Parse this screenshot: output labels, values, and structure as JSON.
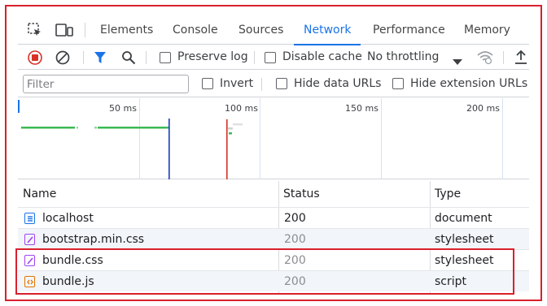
{
  "tabs": [
    {
      "label": "Elements"
    },
    {
      "label": "Console"
    },
    {
      "label": "Sources"
    },
    {
      "label": "Network",
      "active": true
    },
    {
      "label": "Performance"
    },
    {
      "label": "Memory"
    }
  ],
  "toolbar": {
    "preserve_log": "Preserve log",
    "disable_cache": "Disable cache",
    "throttling": "No throttling"
  },
  "filter": {
    "placeholder": "Filter",
    "invert": "Invert",
    "hide_data_urls": "Hide data URLs",
    "hide_extension_urls": "Hide extension URLs"
  },
  "overview": {
    "ticks": [
      "50 ms",
      "100 ms",
      "150 ms",
      "200 ms"
    ]
  },
  "table": {
    "headers": {
      "name": "Name",
      "status": "Status",
      "type": "Type"
    },
    "rows": [
      {
        "name": "localhost",
        "status": "200",
        "type": "document",
        "icon": "document-icon"
      },
      {
        "name": "bootstrap.min.css",
        "status": "200",
        "type": "stylesheet",
        "icon": "stylesheet-icon"
      },
      {
        "name": "bundle.css",
        "status": "200",
        "type": "stylesheet",
        "icon": "stylesheet-icon"
      },
      {
        "name": "bundle.js",
        "status": "200",
        "type": "script",
        "icon": "script-icon"
      }
    ]
  },
  "colors": {
    "accent": "#1a73e8",
    "highlight_border": "#d9202c",
    "record_red": "#d93025"
  }
}
